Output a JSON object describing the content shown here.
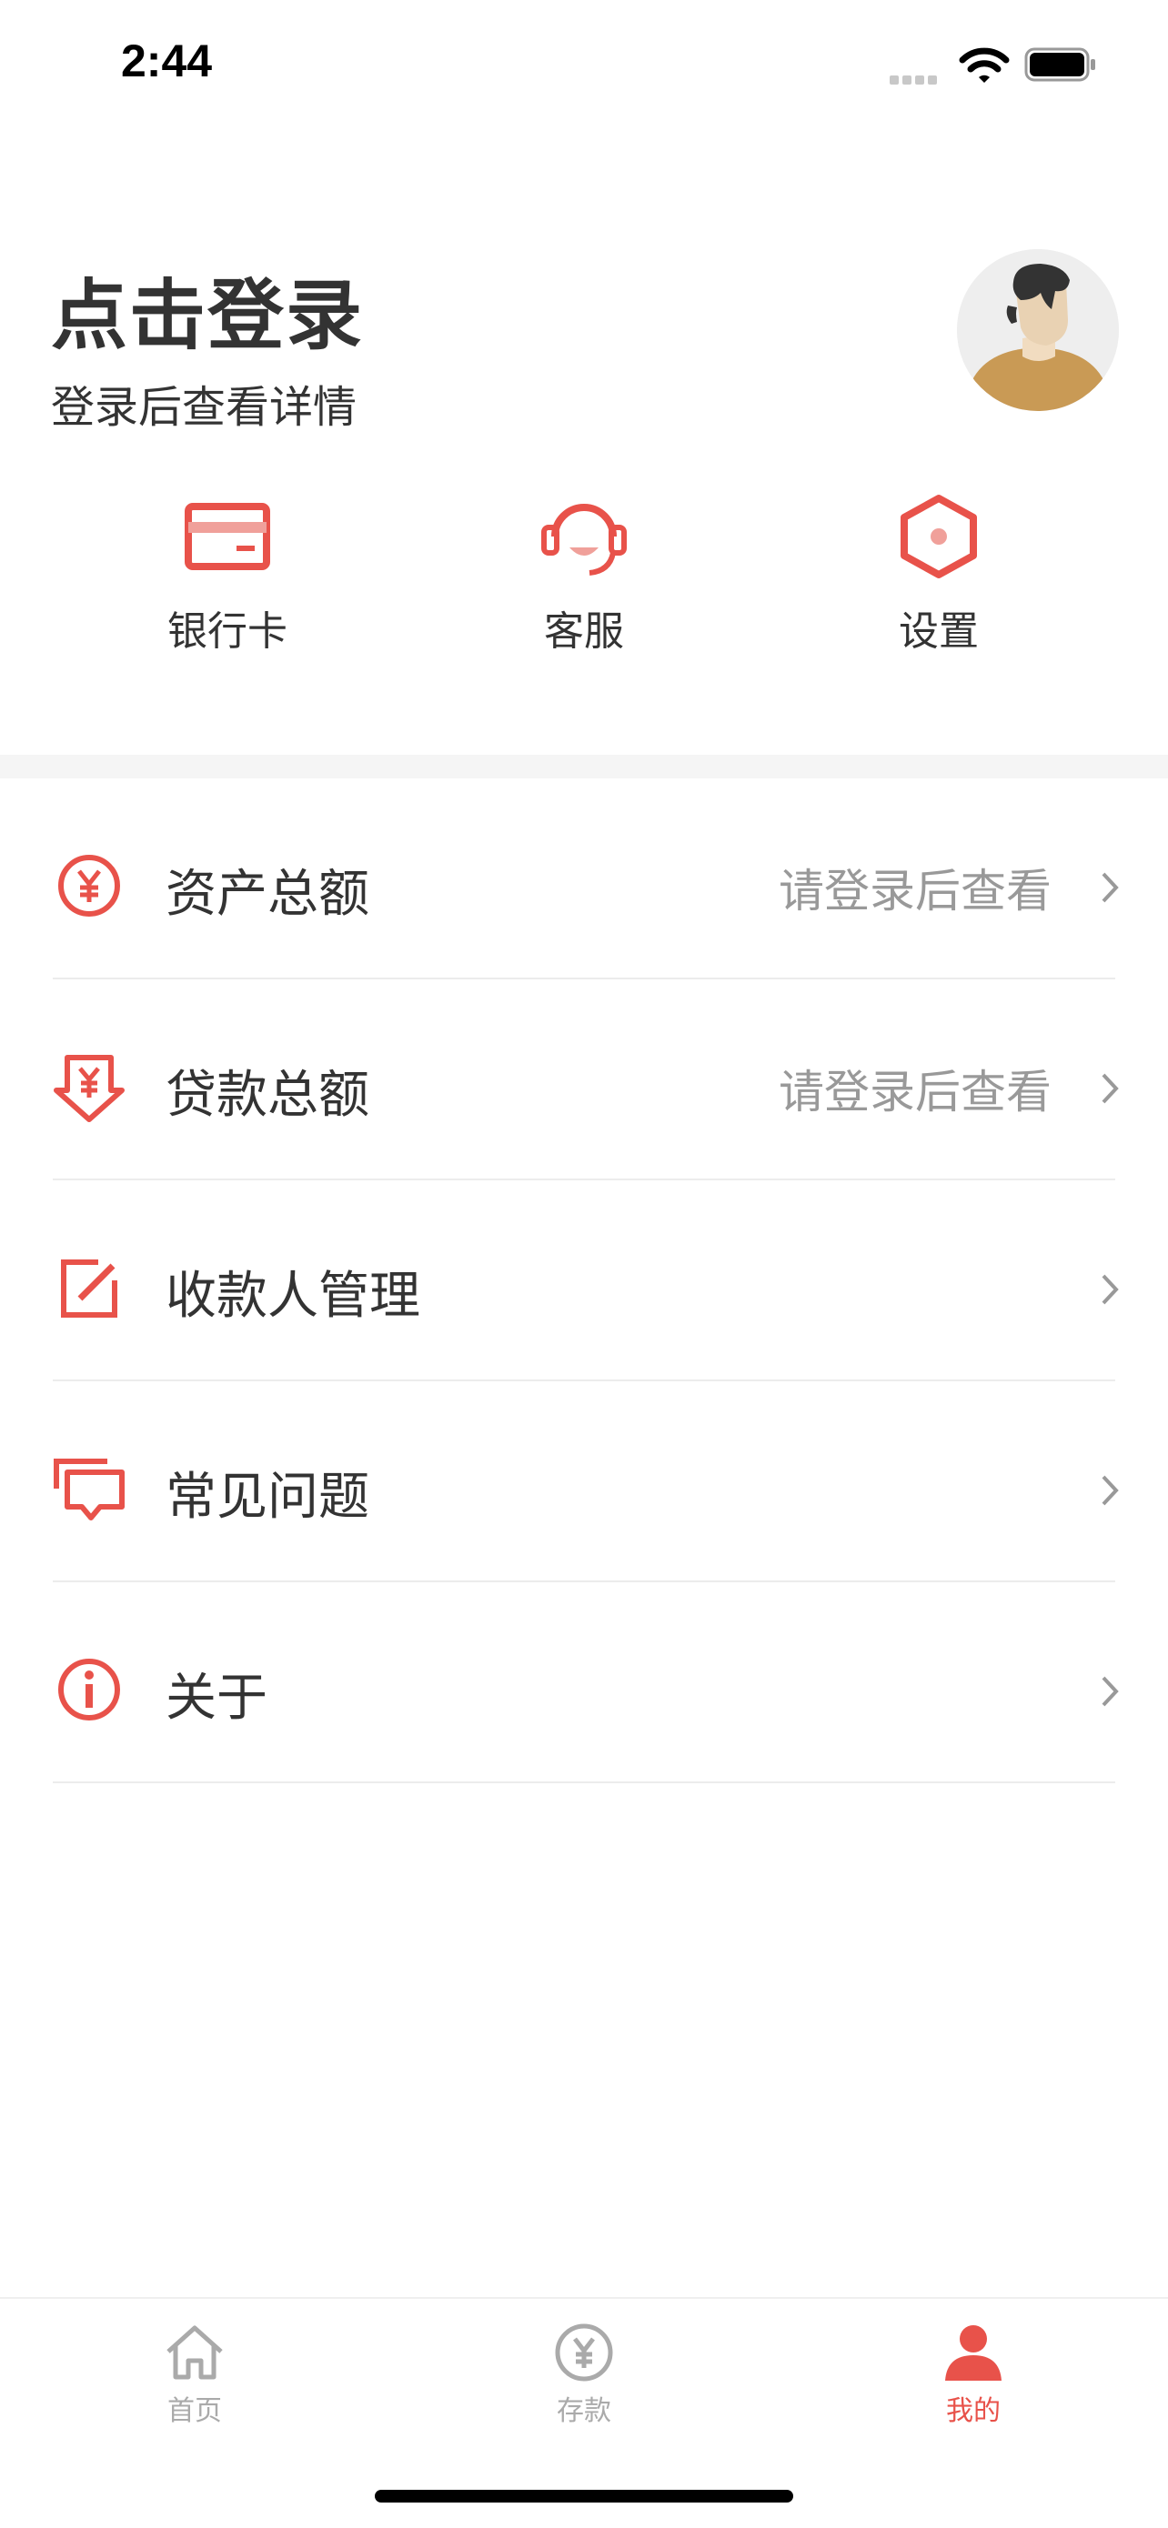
{
  "status_bar": {
    "time": "2:44"
  },
  "profile": {
    "title": "点击登录",
    "subtitle": "登录后查看详情"
  },
  "shortcuts": [
    {
      "label": "银行卡",
      "icon": "bank-card-icon"
    },
    {
      "label": "客服",
      "icon": "headset-icon"
    },
    {
      "label": "设置",
      "icon": "settings-hexagon-icon"
    }
  ],
  "menu": [
    {
      "label": "资产总额",
      "hint": "请登录后查看",
      "icon": "yuan-circle-icon"
    },
    {
      "label": "贷款总额",
      "hint": "请登录后查看",
      "icon": "loan-arrow-icon"
    },
    {
      "label": "收款人管理",
      "hint": "",
      "icon": "edit-icon"
    },
    {
      "label": "常见问题",
      "hint": "",
      "icon": "chat-bubbles-icon"
    },
    {
      "label": "关于",
      "hint": "",
      "icon": "info-icon"
    }
  ],
  "tabbar": {
    "items": [
      {
        "label": "首页",
        "icon": "home-icon",
        "active": false
      },
      {
        "label": "存款",
        "icon": "yuan-tab-icon",
        "active": false
      },
      {
        "label": "我的",
        "icon": "user-icon",
        "active": true
      }
    ]
  },
  "colors": {
    "accent": "#e8524a",
    "inactive": "#aaaaaa",
    "hint": "#999999"
  }
}
